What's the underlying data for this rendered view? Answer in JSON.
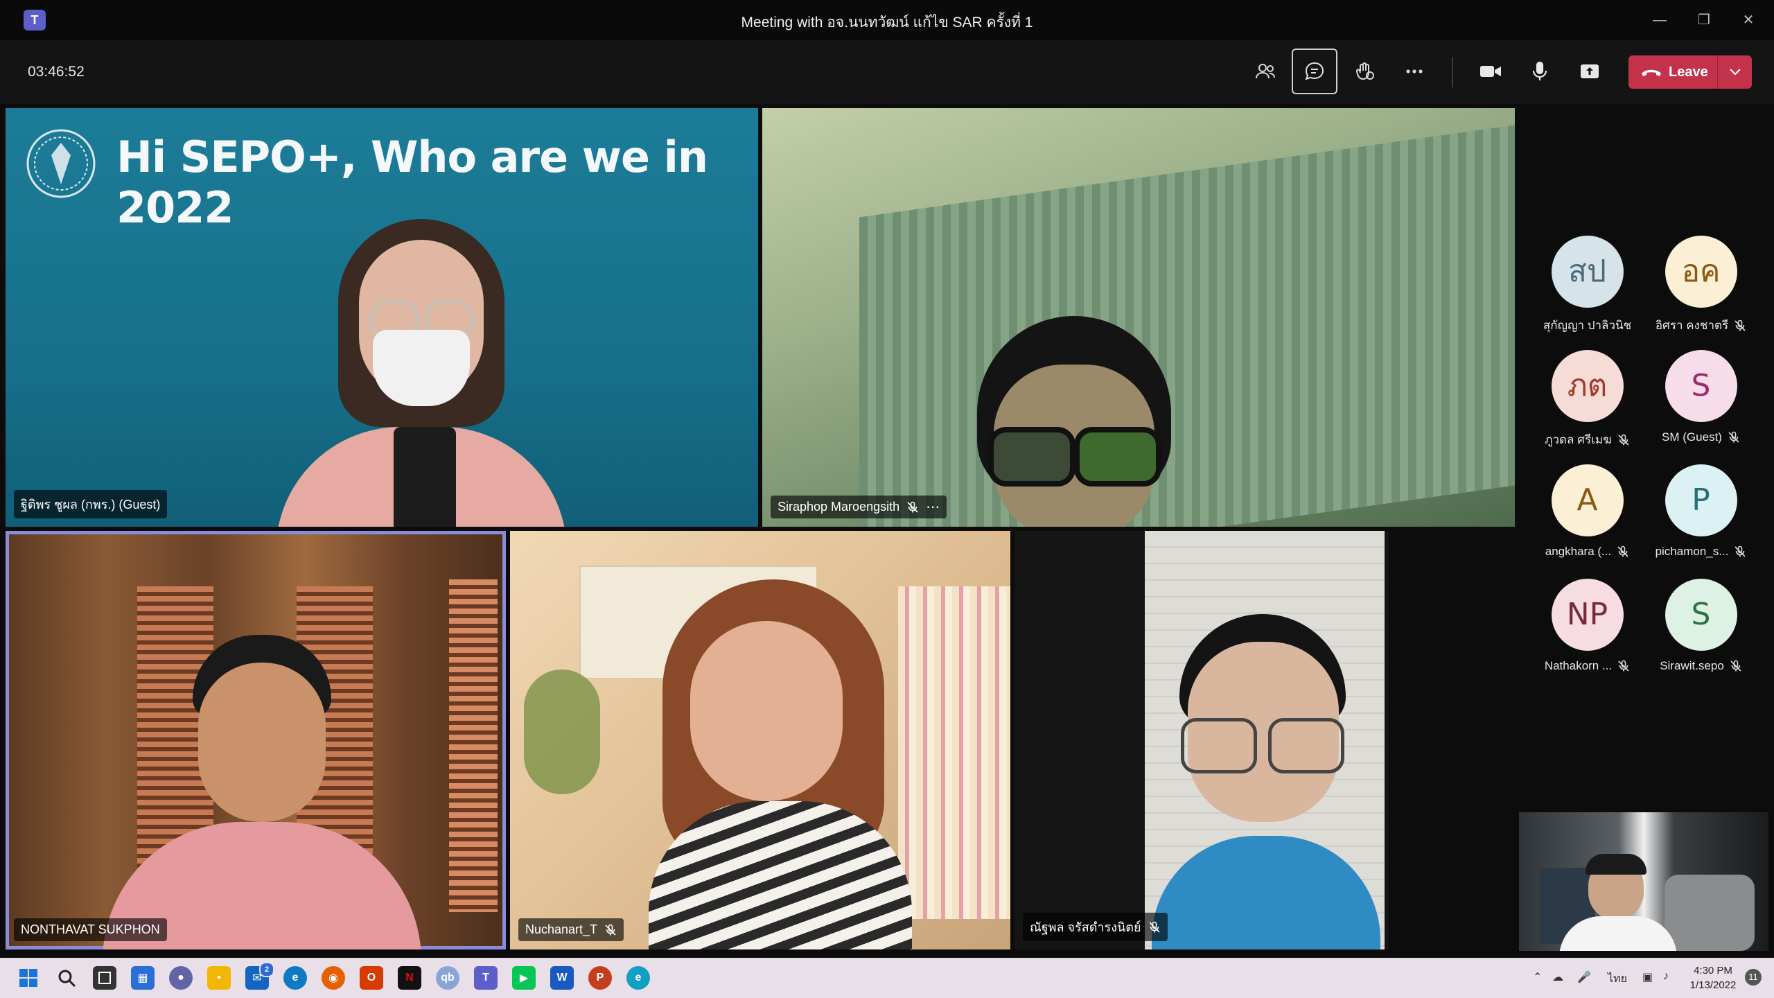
{
  "window": {
    "title": "Meeting with อจ.นนทวัฒน์ แก้ไข SAR ครั้งที่ 1"
  },
  "toolbar": {
    "timer": "03:46:52",
    "leave_label": "Leave"
  },
  "stage": {
    "presenter": {
      "slide_title": "Hi SEPO+, Who are we in 2022",
      "name": "ฐิติพร ชูผล (กพร.) (Guest)"
    },
    "tiles": [
      {
        "name": "Siraphop Maroengsith"
      },
      {
        "name": "NONTHAVAT SUKPHON"
      },
      {
        "name": "Nuchanart_T"
      },
      {
        "name": "ณัฐพล จรัสดำรงนิตย์"
      }
    ]
  },
  "roster": [
    {
      "initials": "สป",
      "name": "สุกัญญา ปาลิวนิช",
      "muted": false,
      "bg": "#d6e4ea",
      "fg": "#4d6a78"
    },
    {
      "initials": "อค",
      "name": "อิศรา คงชาตรี",
      "muted": true,
      "bg": "#fbefd5",
      "fg": "#8a5a12"
    },
    {
      "initials": "ภต",
      "name": "ภูวดล ศรีเมฆ",
      "muted": true,
      "bg": "#f6dcd7",
      "fg": "#a13a2a"
    },
    {
      "initials": "S",
      "name": "SM (Guest)",
      "muted": true,
      "bg": "#f6dde9",
      "fg": "#9b2c6b"
    },
    {
      "initials": "A",
      "name": "angkhara (...",
      "muted": true,
      "bg": "#fbefd5",
      "fg": "#8a5a12"
    },
    {
      "initials": "P",
      "name": "pichamon_s...",
      "muted": true,
      "bg": "#dcf1f3",
      "fg": "#2a6f77"
    },
    {
      "initials": "NP",
      "name": "Nathakorn ...",
      "muted": true,
      "bg": "#f6dde1",
      "fg": "#7a2a36"
    },
    {
      "initials": "S",
      "name": "Sirawit.sepo",
      "muted": true,
      "bg": "#ddf1e4",
      "fg": "#2e7243"
    }
  ],
  "taskbar": {
    "language": "ไทย",
    "time": "4:30 PM",
    "date": "1/13/2022",
    "notifications": "11",
    "mail_badge": "2"
  }
}
